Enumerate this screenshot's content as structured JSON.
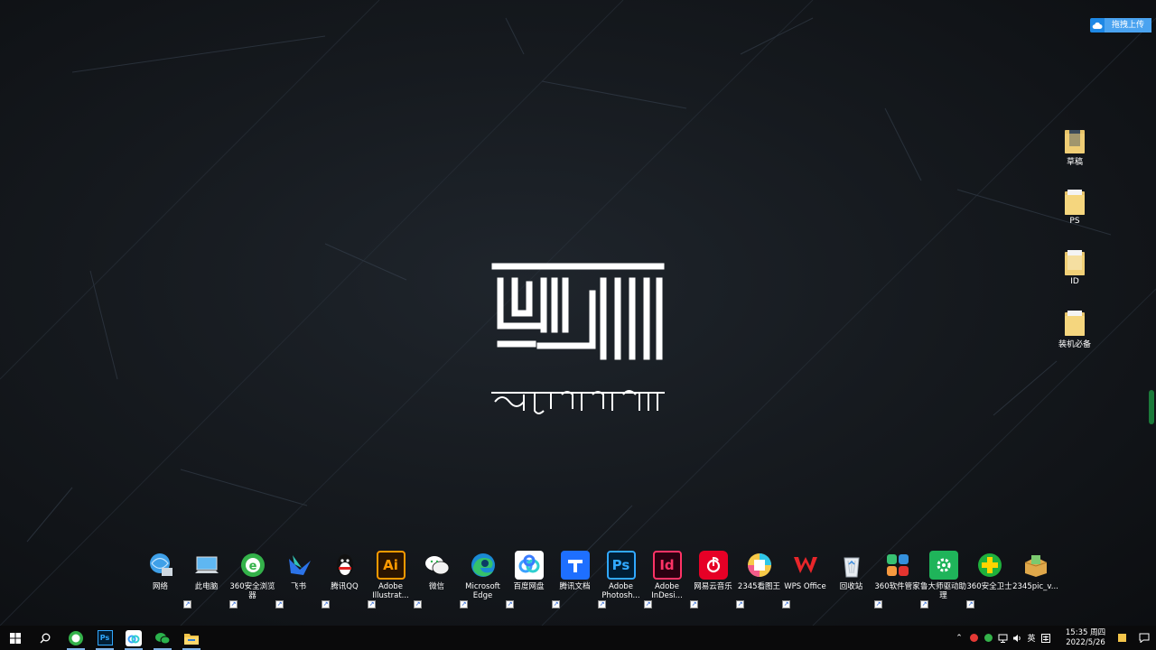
{
  "cloud_upload": {
    "label": "拖拽上传"
  },
  "wallpaper": {
    "logo_text": "ཀུ་ཡི་ཀློང་པ་ཁེབ།"
  },
  "right_folders": [
    {
      "label": "草稿",
      "icon": "image-folder-icon"
    },
    {
      "label": "PS",
      "icon": "folder-icon"
    },
    {
      "label": "ID",
      "icon": "folder-icon"
    },
    {
      "label": "装机必备",
      "icon": "folder-icon"
    }
  ],
  "desktop_icons": [
    {
      "label": "网络",
      "icon": "network-icon"
    },
    {
      "label": "此电脑",
      "icon": "computer-icon"
    },
    {
      "label": "360安全浏览器",
      "icon": "360-browser-icon"
    },
    {
      "label": "飞书",
      "icon": "feishu-icon"
    },
    {
      "label": "腾讯QQ",
      "icon": "qq-icon"
    },
    {
      "label": "Adobe Illustrat...",
      "icon": "illustrator-icon"
    },
    {
      "label": "微信",
      "icon": "wechat-icon"
    },
    {
      "label": "Microsoft Edge",
      "icon": "edge-icon"
    },
    {
      "label": "百度网盘",
      "icon": "baidu-netdisk-icon"
    },
    {
      "label": "腾讯文档",
      "icon": "tencent-docs-icon"
    },
    {
      "label": "Adobe Photosh...",
      "icon": "photoshop-icon"
    },
    {
      "label": "Adobe InDesi...",
      "icon": "indesign-icon"
    },
    {
      "label": "网易云音乐",
      "icon": "netease-music-icon"
    },
    {
      "label": "2345看图王",
      "icon": "2345-viewer-icon"
    },
    {
      "label": "WPS Office",
      "icon": "wps-icon"
    },
    {
      "label": "回收站",
      "icon": "recycle-bin-icon"
    },
    {
      "label": "360软件管家",
      "icon": "360-software-icon"
    },
    {
      "label": "鲁大师驱动助理",
      "icon": "driver-assistant-icon"
    },
    {
      "label": "360安全卫士",
      "icon": "360-security-icon"
    },
    {
      "label": "2345pic_v...",
      "icon": "2345pic-installer-icon"
    }
  ],
  "taskbar": {
    "pinned": [
      {
        "name": "360-browser",
        "icon": "360-browser-icon"
      },
      {
        "name": "photoshop",
        "icon": "photoshop-icon"
      },
      {
        "name": "baidu-netdisk",
        "icon": "baidu-netdisk-icon"
      },
      {
        "name": "wechat",
        "icon": "wechat-icon"
      },
      {
        "name": "file-explorer",
        "icon": "file-explorer-icon"
      }
    ],
    "ime": "英",
    "time": "15:35 周四",
    "date": "2022/5/26"
  },
  "colors": {
    "taskbar": "#0a0a0b",
    "accent": "#1e88e5",
    "desktop": "#161a1f"
  }
}
